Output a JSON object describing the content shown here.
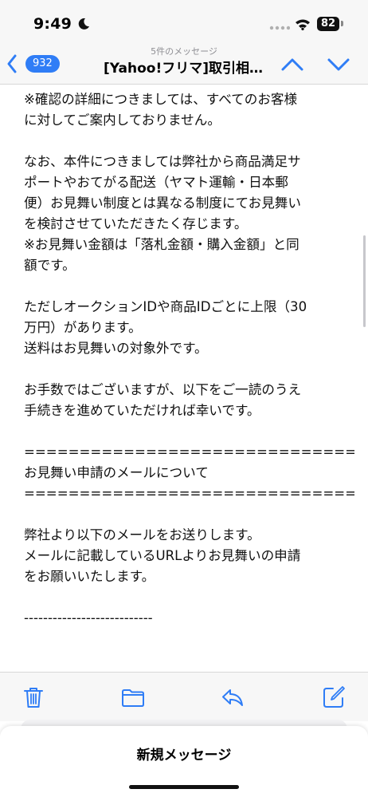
{
  "status_bar": {
    "time": "9:49",
    "battery": "82"
  },
  "nav": {
    "subtitle": "5件のメッセージ",
    "unread_count": "932",
    "title": "[Yahoo!フリマ]取引相…"
  },
  "mail": {
    "lines": [
      "※確認の詳細につきましては、すべてのお客様",
      "に対してご案内しておりません。",
      "",
      "なお、本件につきましては弊社から商品満足サ",
      "ポートやおてがる配送（ヤマト運輸・日本郵",
      "便）お見舞い制度とは異なる制度にてお見舞い",
      "を検討させていただきたく存じます。",
      "※お見舞い金額は「落札金額・購入金額」と同",
      "額です。",
      "",
      "ただしオークションIDや商品IDごとに上限（30",
      "万円）があります。",
      "送料はお見舞いの対象外です。",
      "",
      "お手数ではございますが、以下をご一読のうえ",
      "手続きを進めていただければ幸いです。",
      "",
      "==============================",
      "お見舞い申請のメールについて",
      "==============================",
      "",
      "弊社より以下のメールをお送りします。",
      "メールに記載しているURLよりお見舞いの申請",
      "をお願いいたします。",
      "",
      "---------------------------"
    ]
  },
  "toolbar": {
    "icons": [
      "trash-icon",
      "folder-icon",
      "reply-icon",
      "compose-icon"
    ]
  },
  "draft_sheet": {
    "title": "新規メッセージ"
  }
}
